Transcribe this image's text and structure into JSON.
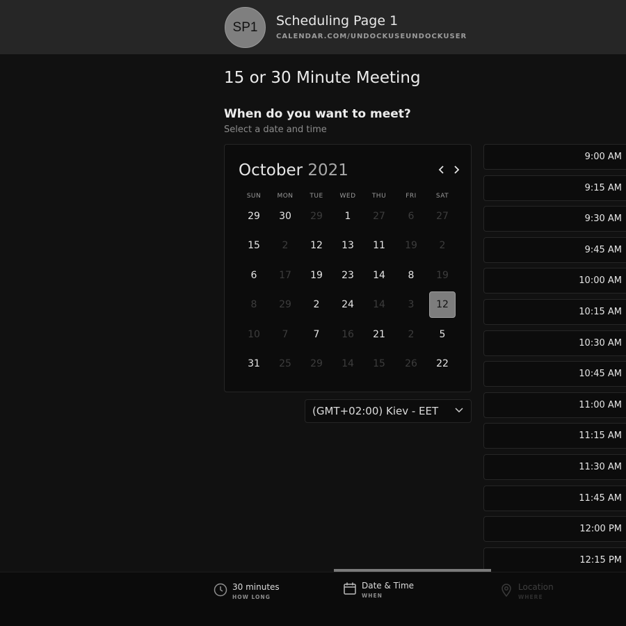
{
  "header": {
    "avatar_initials": "SP1",
    "title": "Scheduling Page 1",
    "url": "CALENDAR.COM/UNDOCKUSEUNDOCKUSER"
  },
  "meeting_title": "15 or 30 Minute Meeting",
  "question": "When do you want to meet?",
  "subtitle": "Select a date and time",
  "calendar": {
    "month": "October",
    "year": "2021",
    "prev_icon": "chevron-left-icon",
    "next_icon": "chevron-right-icon",
    "weekdays": [
      "SUN",
      "MON",
      "TUE",
      "WED",
      "THU",
      "FRI",
      "SAT"
    ],
    "weeks": [
      [
        {
          "d": "29",
          "dim": false
        },
        {
          "d": "30",
          "dim": false
        },
        {
          "d": "29",
          "dim": true
        },
        {
          "d": "1",
          "dim": false
        },
        {
          "d": "27",
          "dim": true
        },
        {
          "d": "6",
          "dim": true
        },
        {
          "d": "27",
          "dim": true
        }
      ],
      [
        {
          "d": "15",
          "dim": false
        },
        {
          "d": "2",
          "dim": true
        },
        {
          "d": "12",
          "dim": false
        },
        {
          "d": "13",
          "dim": false
        },
        {
          "d": "11",
          "dim": false
        },
        {
          "d": "19",
          "dim": true
        },
        {
          "d": "2",
          "dim": true
        }
      ],
      [
        {
          "d": "6",
          "dim": false
        },
        {
          "d": "17",
          "dim": true
        },
        {
          "d": "19",
          "dim": false
        },
        {
          "d": "23",
          "dim": false
        },
        {
          "d": "14",
          "dim": false
        },
        {
          "d": "8",
          "dim": false
        },
        {
          "d": "19",
          "dim": true
        }
      ],
      [
        {
          "d": "8",
          "dim": true
        },
        {
          "d": "29",
          "dim": true
        },
        {
          "d": "2",
          "dim": false
        },
        {
          "d": "24",
          "dim": false
        },
        {
          "d": "14",
          "dim": true
        },
        {
          "d": "3",
          "dim": true
        },
        {
          "d": "12",
          "dim": false,
          "selected": true
        }
      ],
      [
        {
          "d": "10",
          "dim": true
        },
        {
          "d": "7",
          "dim": true
        },
        {
          "d": "7",
          "dim": false
        },
        {
          "d": "16",
          "dim": true
        },
        {
          "d": "21",
          "dim": false
        },
        {
          "d": "2",
          "dim": true
        },
        {
          "d": "5",
          "dim": false
        }
      ],
      [
        {
          "d": "31",
          "dim": false
        },
        {
          "d": "25",
          "dim": true
        },
        {
          "d": "29",
          "dim": true
        },
        {
          "d": "14",
          "dim": true
        },
        {
          "d": "15",
          "dim": true
        },
        {
          "d": "26",
          "dim": true
        },
        {
          "d": "22",
          "dim": false
        }
      ]
    ]
  },
  "timezone": {
    "value": "(GMT+02:00) Kiev - EET",
    "icon": "chevron-down-icon"
  },
  "time_slots": [
    "9:00 AM",
    "9:15 AM",
    "9:30 AM",
    "9:45 AM",
    "10:00 AM",
    "10:15 AM",
    "10:30 AM",
    "10:45 AM",
    "11:00 AM",
    "11:15 AM",
    "11:30 AM",
    "11:45 AM",
    "12:00 PM",
    "12:15 PM"
  ],
  "footer": {
    "steps": [
      {
        "label": "30 minutes",
        "sub": "HOW LONG",
        "icon": "clock-icon",
        "active": false
      },
      {
        "label": "Date & Time",
        "sub": "WHEN",
        "icon": "calendar-icon",
        "active": true
      },
      {
        "label": "Location",
        "sub": "WHERE",
        "icon": "location-pin-icon",
        "active": false
      }
    ]
  },
  "colors": {
    "background": "#111111",
    "header": "#262626",
    "panel": "#0c0c0c",
    "selected_day": "#7d7d7d",
    "step_indicator": "#7a7a7a"
  }
}
